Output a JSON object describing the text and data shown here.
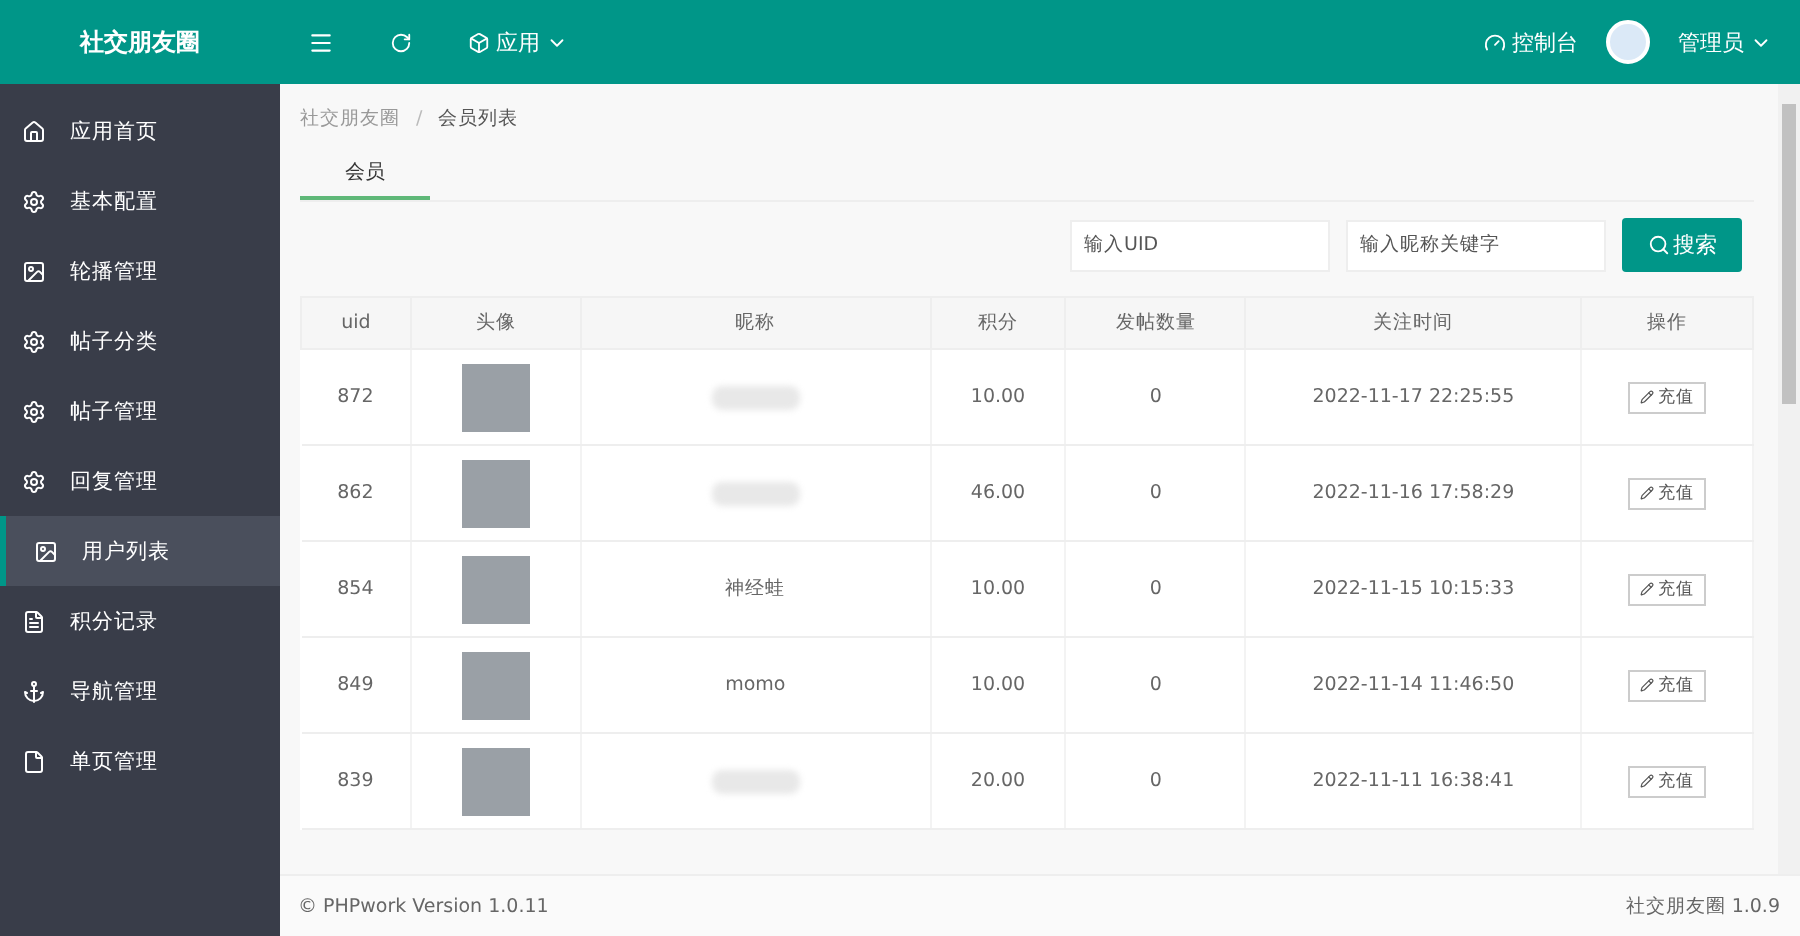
{
  "header": {
    "brand": "社交朋友圈",
    "app_menu": "应用",
    "console": "控制台",
    "user": "管理员"
  },
  "sidebar": {
    "items": [
      {
        "label": "应用首页",
        "selected": false
      },
      {
        "label": "基本配置",
        "selected": false
      },
      {
        "label": "轮播管理",
        "selected": false
      },
      {
        "label": "帖子分类",
        "selected": false
      },
      {
        "label": "帖子管理",
        "selected": false
      },
      {
        "label": "回复管理",
        "selected": false
      },
      {
        "label": "用户列表",
        "selected": true
      },
      {
        "label": "积分记录",
        "selected": false
      },
      {
        "label": "导航管理",
        "selected": false
      },
      {
        "label": "单页管理",
        "selected": false
      }
    ]
  },
  "breadcrumb": {
    "separator": "/",
    "items": [
      "社交朋友圈",
      "会员列表"
    ]
  },
  "tabs": [
    {
      "label": "会员",
      "selected": true
    }
  ],
  "search": {
    "uid_placeholder": "输入UID",
    "name_placeholder": "输入昵称关键字",
    "button": "搜索"
  },
  "table": {
    "columns": [
      "uid",
      "头像",
      "昵称",
      "积分",
      "发帖数量",
      "关注时间",
      "操作"
    ],
    "rows": [
      {
        "uid": "872",
        "nickname_blurred": true,
        "points": "10.00",
        "posts": "0",
        "time": "2022-11-17 22:25:55",
        "action": "充值"
      },
      {
        "uid": "862",
        "nickname_blurred": true,
        "points": "46.00",
        "posts": "0",
        "time": "2022-11-16 17:58:29",
        "action": "充值"
      },
      {
        "uid": "854",
        "nickname": "神经蛙",
        "nickname_blurred": false,
        "points": "10.00",
        "posts": "0",
        "time": "2022-11-15 10:15:33",
        "action": "充值"
      },
      {
        "uid": "849",
        "nickname": "momo",
        "nickname_blurred": false,
        "points": "10.00",
        "posts": "0",
        "time": "2022-11-14 11:46:50",
        "action": "充值"
      },
      {
        "uid": "839",
        "nickname_blurred": true,
        "points": "20.00",
        "posts": "0",
        "time": "2022-11-11 16:38:41",
        "action": "充值"
      }
    ]
  },
  "footer": {
    "left": "© PHPwork Version 1.0.11",
    "right": "社交朋友圈 1.0.9"
  }
}
